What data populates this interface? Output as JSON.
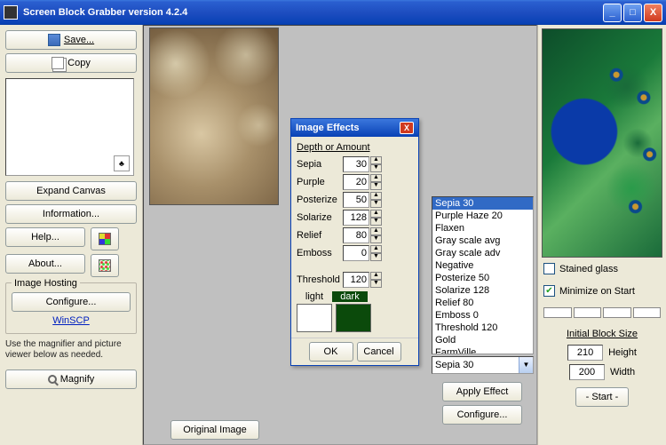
{
  "window": {
    "title": "Screen Block Grabber    version 4.2.4"
  },
  "left": {
    "save": "Save...",
    "copy": "Copy",
    "expand": "Expand Canvas",
    "info": "Information...",
    "help": "Help...",
    "about": "About...",
    "hosting_legend": "Image Hosting",
    "configure": "Configure...",
    "winscp": "WinSCP",
    "hint": "Use the magnifier and picture viewer below as needed.",
    "magnify": "Magnify"
  },
  "mid": {
    "original": "Original Image"
  },
  "dialog": {
    "title": "Image Effects",
    "depth": "Depth or Amount",
    "rows": [
      {
        "label": "Sepia",
        "value": "30"
      },
      {
        "label": "Purple",
        "value": "20"
      },
      {
        "label": "Posterize",
        "value": "50"
      },
      {
        "label": "Solarize",
        "value": "128"
      },
      {
        "label": "Relief",
        "value": "80"
      },
      {
        "label": "Emboss",
        "value": "0"
      }
    ],
    "threshold_label": "Threshold",
    "threshold_value": "120",
    "light": "light",
    "dark": "dark",
    "ok": "OK",
    "cancel": "Cancel"
  },
  "list": {
    "items": [
      "Sepia  30",
      "Purple Haze  20",
      "Flaxen",
      "Gray scale avg",
      "Gray scale adv",
      "Negative",
      "Posterize   50",
      "Solarize  128",
      "Relief  80",
      "Emboss  0",
      "Threshold   120",
      "Gold",
      "FarmVille"
    ],
    "selected": 0,
    "combo": "Sepia  30",
    "apply": "Apply Effect",
    "configure": "Configure..."
  },
  "right": {
    "stained": "Stained glass",
    "minimize": "Minimize on Start",
    "block_title": "Initial Block Size",
    "height_val": "210",
    "height_lbl": "Height",
    "width_val": "200",
    "width_lbl": "Width",
    "start": "- Start -"
  }
}
